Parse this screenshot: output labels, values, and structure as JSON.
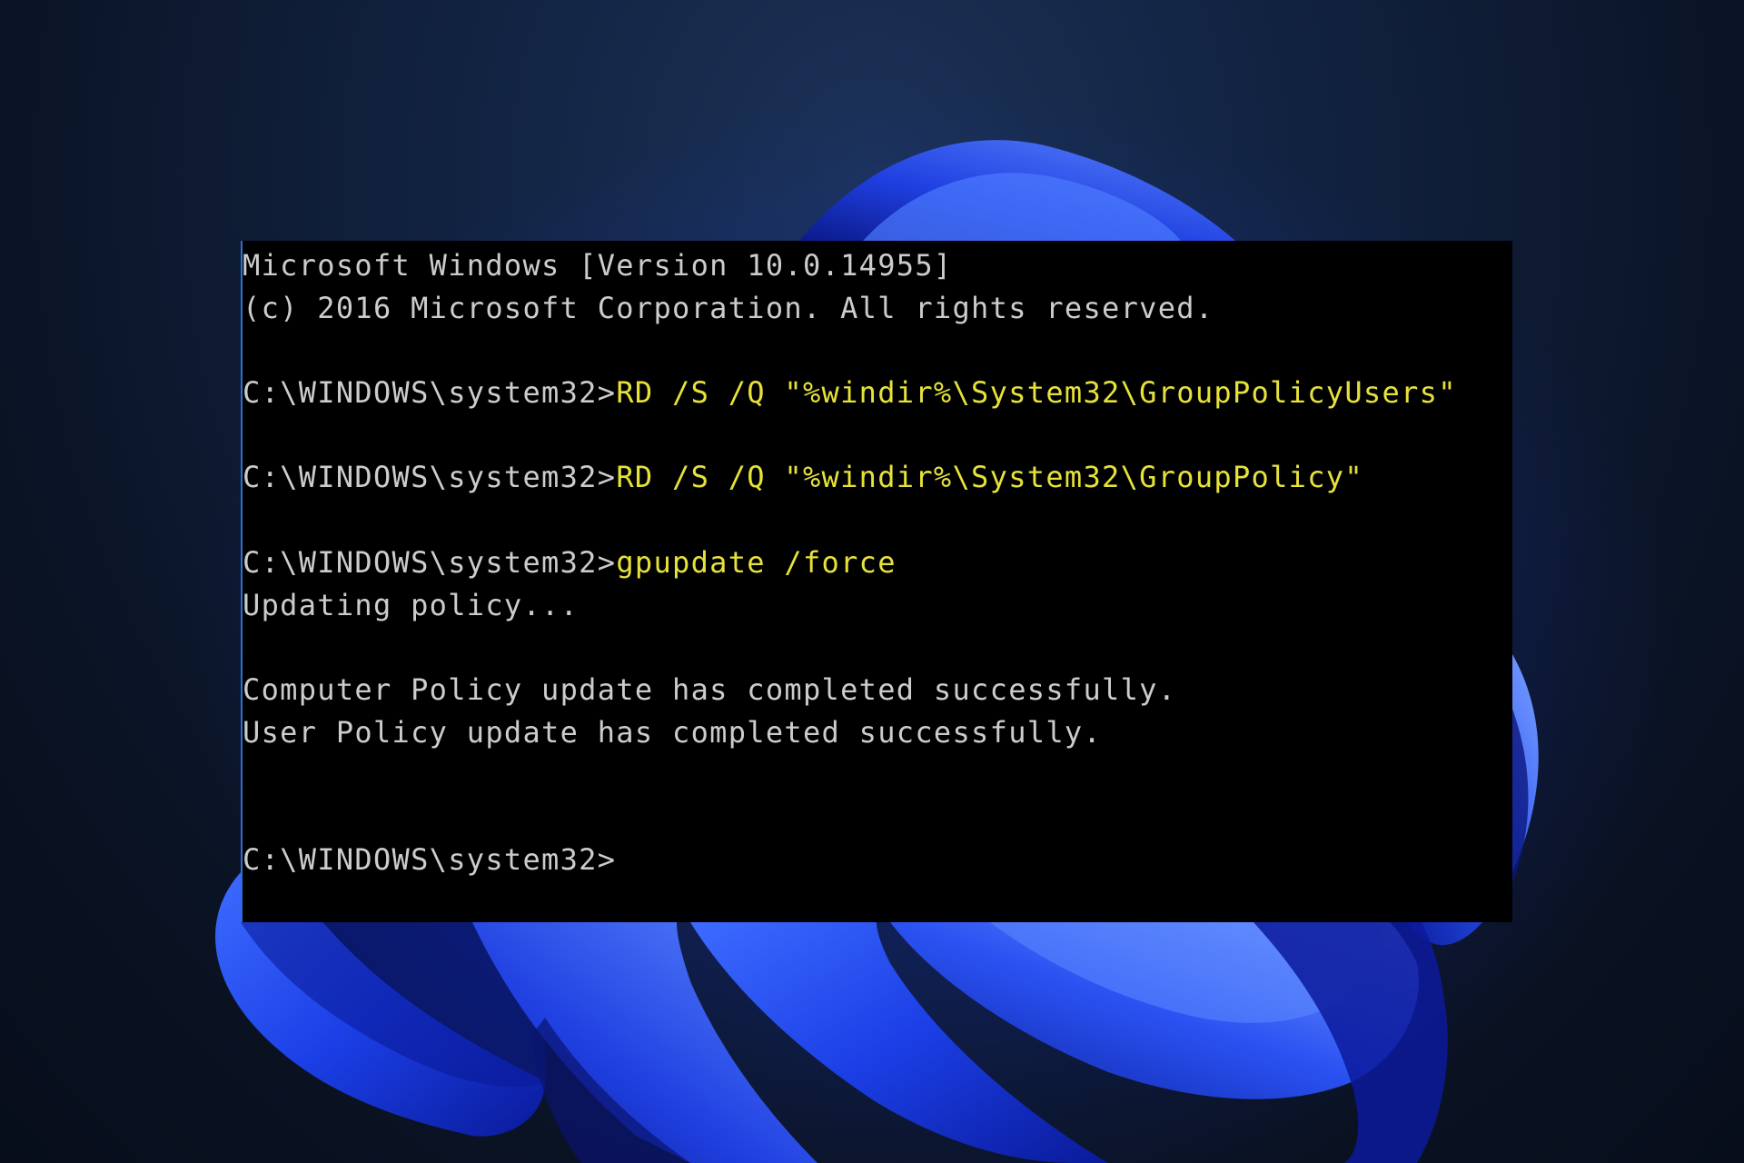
{
  "console": {
    "lines": [
      {
        "text": "Microsoft Windows [Version 10.0.14955]"
      },
      {
        "text": "(c) 2016 Microsoft Corporation. All rights reserved."
      },
      {
        "text": ""
      },
      {
        "prompt": "C:\\WINDOWS\\system32>",
        "command": "RD /S /Q \"%windir%\\System32\\GroupPolicyUsers\""
      },
      {
        "text": ""
      },
      {
        "prompt": "C:\\WINDOWS\\system32>",
        "command": "RD /S /Q \"%windir%\\System32\\GroupPolicy\""
      },
      {
        "text": ""
      },
      {
        "prompt": "C:\\WINDOWS\\system32>",
        "command": "gpupdate /force"
      },
      {
        "text": "Updating policy..."
      },
      {
        "text": ""
      },
      {
        "text": "Computer Policy update has completed successfully."
      },
      {
        "text": "User Policy update has completed successfully."
      },
      {
        "text": ""
      },
      {
        "text": ""
      },
      {
        "prompt": "C:\\WINDOWS\\system32>",
        "command": ""
      }
    ]
  },
  "colors": {
    "console_background": "#000000",
    "output_text": "#cccccc",
    "command_text": "#e6e23a",
    "desktop_background": "#0c1629",
    "bloom_accent": "#1f3fe0"
  },
  "wallpaper": {
    "icon": "windows-11-bloom-wallpaper"
  }
}
